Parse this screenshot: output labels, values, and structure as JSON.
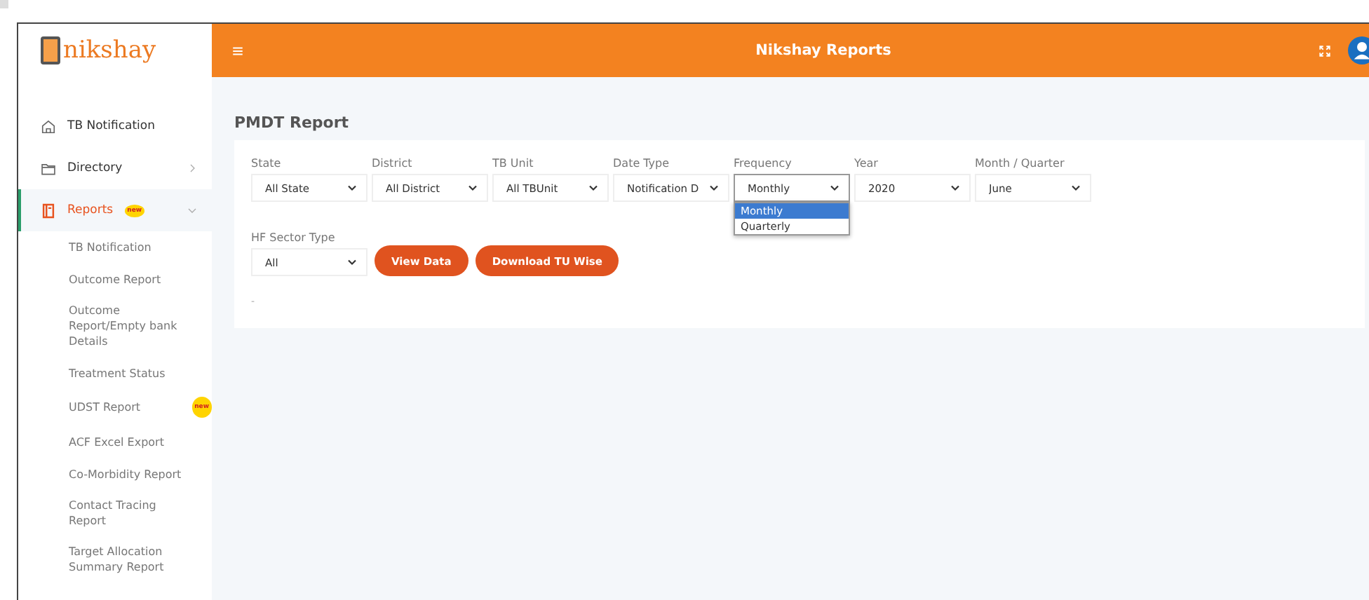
{
  "header": {
    "logo": "nikshay",
    "title": "Nikshay Reports"
  },
  "sidebar": {
    "items": [
      {
        "label": "TB Notification",
        "selected": false
      },
      {
        "label": "Directory",
        "selected": false,
        "expanded": false
      },
      {
        "label": "Reports",
        "selected": true,
        "expanded": true,
        "badge": "new",
        "children": [
          {
            "label": "TB Notification"
          },
          {
            "label": "Outcome Report"
          },
          {
            "label": "Outcome Report/Empty bank Details"
          },
          {
            "label": "Treatment Status"
          },
          {
            "label": "UDST Report",
            "badge": "new"
          },
          {
            "label": "ACF Excel Export"
          },
          {
            "label": "Co-Morbidity Report"
          },
          {
            "label": "Contact Tracing Report"
          },
          {
            "label": "Target Allocation Summary Report"
          }
        ]
      }
    ]
  },
  "page_title": "PMDT Report",
  "filters": [
    {
      "label": "State",
      "value": "All State",
      "open": false
    },
    {
      "label": "District",
      "value": "All District",
      "open": false
    },
    {
      "label": "TB Unit",
      "value": "All TBUnit",
      "open": false
    },
    {
      "label": "Date Type",
      "value": "Notification D",
      "open": false
    },
    {
      "label": "Frequency",
      "value": "Monthly",
      "open": true,
      "options": [
        {
          "label": "Monthly",
          "selected": true
        },
        {
          "label": "Quarterly",
          "selected": false
        }
      ]
    },
    {
      "label": "Year",
      "value": "2020",
      "open": false
    },
    {
      "label": "Month / Quarter",
      "value": "June",
      "open": false
    }
  ],
  "filters_row2": [
    {
      "label": "HF Sector Type",
      "value": "All",
      "open": false
    }
  ],
  "buttons": [
    "View Data",
    "Download TU Wise"
  ],
  "note": "-"
}
